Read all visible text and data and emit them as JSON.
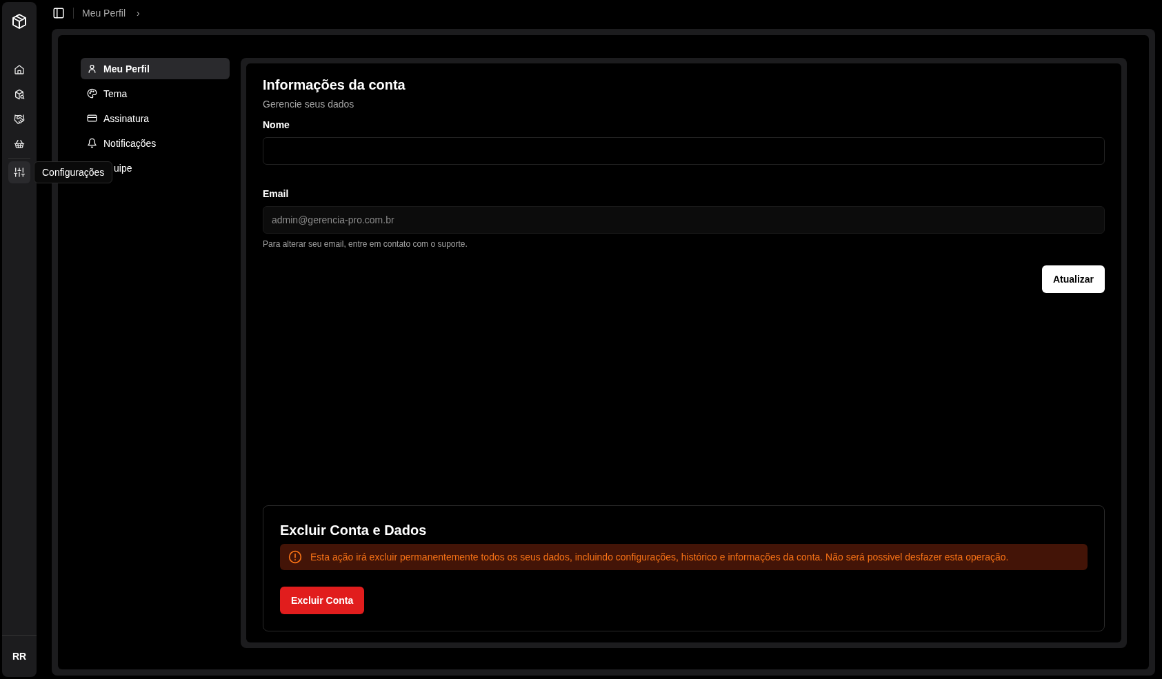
{
  "rail": {
    "items": [
      {
        "selected": false
      },
      {
        "selected": false
      },
      {
        "selected": false
      },
      {
        "selected": false
      },
      {
        "selected": true
      }
    ],
    "tooltip": "Configurações",
    "avatar": "RR"
  },
  "breadcrumb": {
    "current": "Meu Perfil",
    "separator": "›"
  },
  "settings_menu": [
    {
      "label": "Meu Perfil",
      "selected": true
    },
    {
      "label": "Tema",
      "selected": false
    },
    {
      "label": "Assinatura",
      "selected": false
    },
    {
      "label": "Notificações",
      "selected": false
    },
    {
      "label": "uipe",
      "selected": false
    }
  ],
  "account": {
    "title": "Informações da conta",
    "subtitle": "Gerencie seus dados",
    "fields": [
      {
        "label": "Nome",
        "disabled": false
      },
      {
        "label": "Email",
        "value": "admin@gerencia-pro.com.br",
        "disabled": true
      }
    ],
    "email_hint": "Para alterar seu email, entre em contato com o suporte.",
    "update_button": "Atualizar"
  },
  "danger": {
    "title": "Excluir Conta e Dados",
    "warning": "Esta ação irá excluir permanentemente todos os seus dados, incluindo configurações, histórico e informações da conta. Não será possivel desfazer esta operação.",
    "button": "Excluir Conta"
  }
}
